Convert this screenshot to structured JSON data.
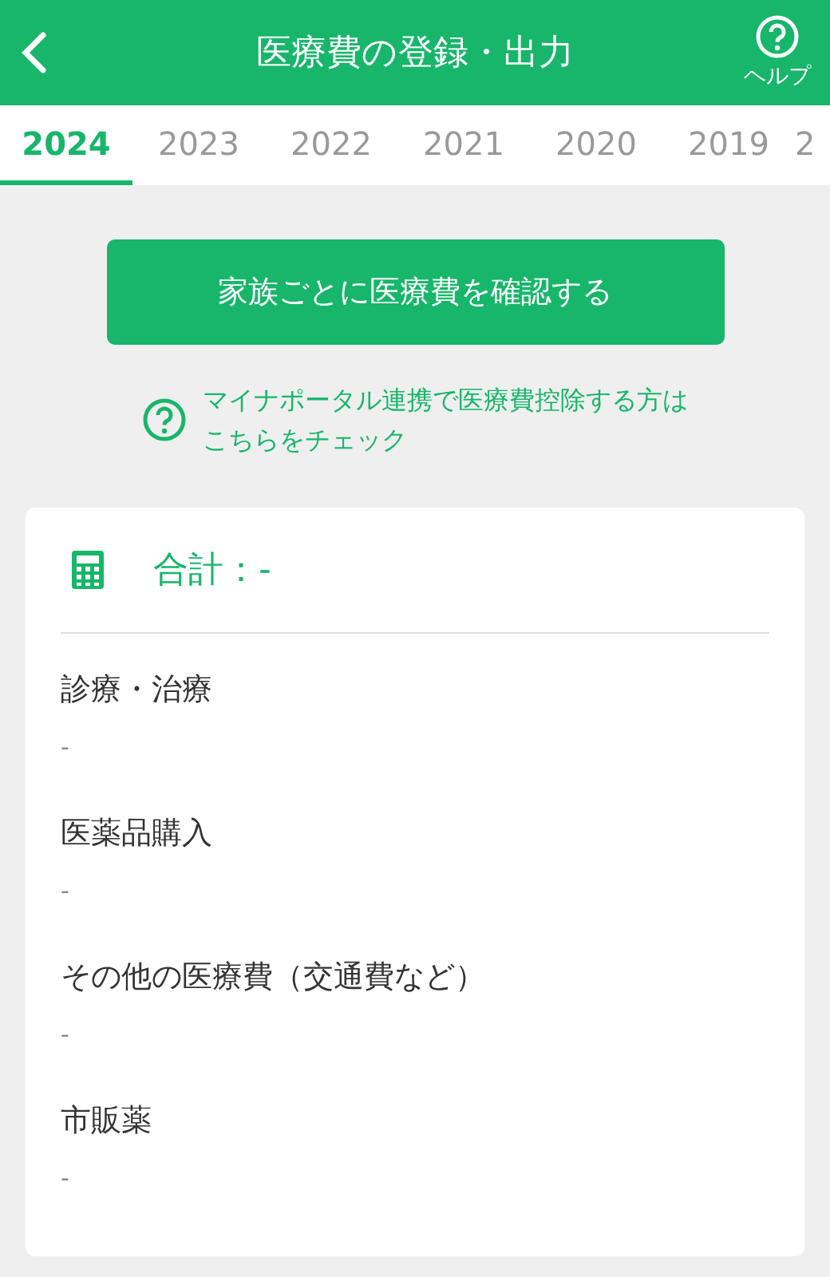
{
  "header": {
    "title": "医療費の登録・出力",
    "help_label": "ヘルプ"
  },
  "tabs": [
    {
      "label": "2024",
      "selected": true
    },
    {
      "label": "2023",
      "selected": false
    },
    {
      "label": "2022",
      "selected": false
    },
    {
      "label": "2021",
      "selected": false
    },
    {
      "label": "2020",
      "selected": false
    },
    {
      "label": "2019",
      "selected": false
    },
    {
      "label": "2",
      "selected": false
    }
  ],
  "family_button": "家族ごとに医療費を確認する",
  "help_link": "マイナポータル連携で医療費控除する方はこちらをチェック",
  "summary": {
    "total_label": "合計：-",
    "items": [
      {
        "label": "診療・治療",
        "value": "-"
      },
      {
        "label": "医薬品購入",
        "value": "-"
      },
      {
        "label": "その他の医療費（交通費など）",
        "value": "-"
      },
      {
        "label": "市販薬",
        "value": "-"
      }
    ]
  }
}
